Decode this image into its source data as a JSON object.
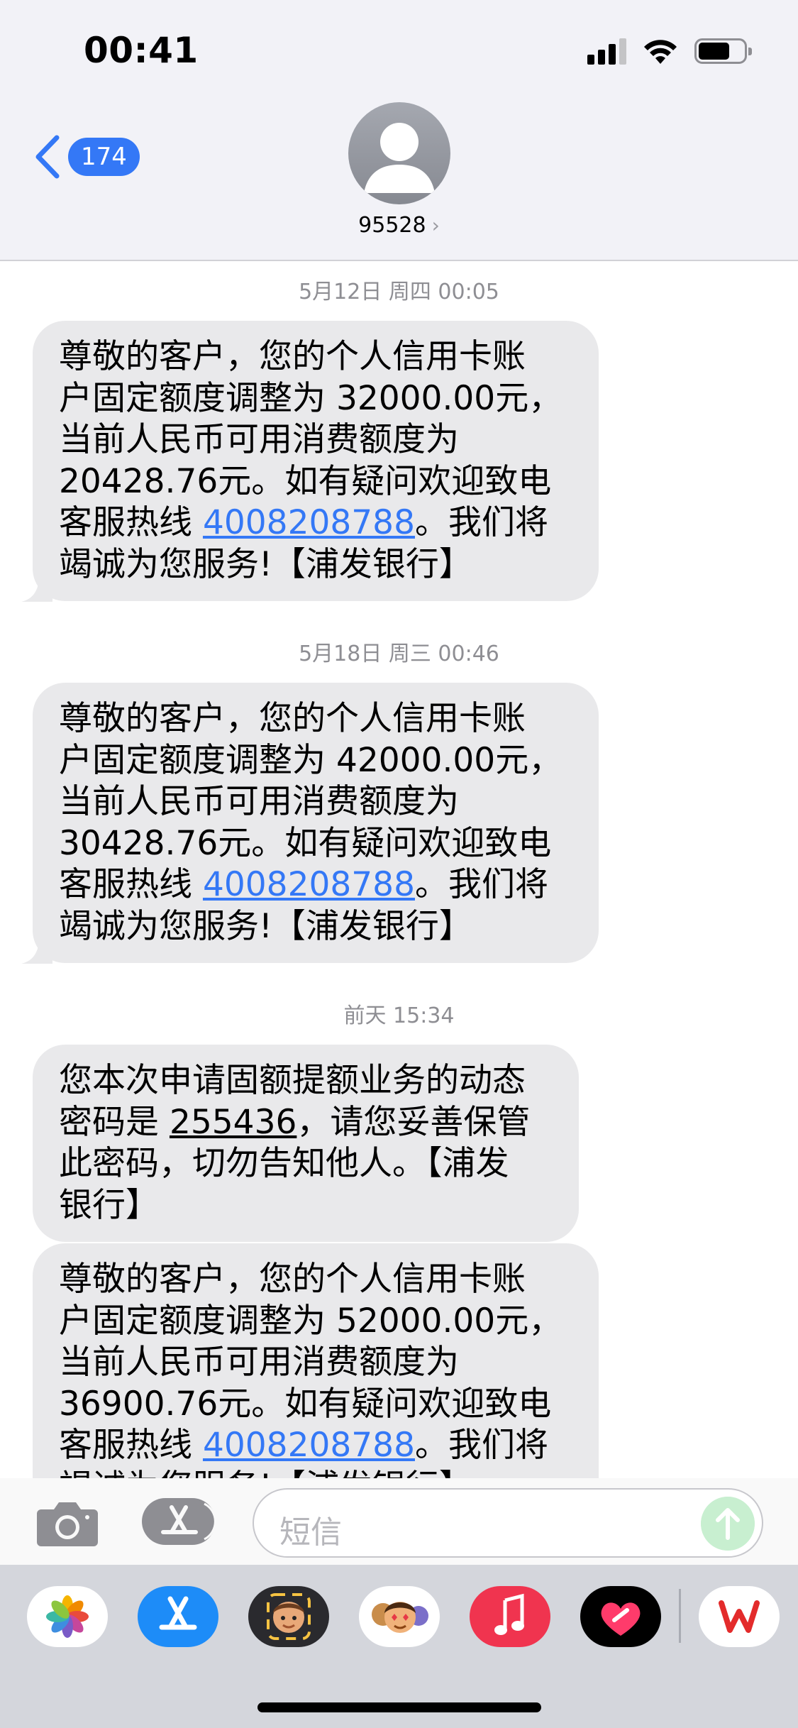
{
  "status_bar": {
    "time": "00:41"
  },
  "header": {
    "back_count": "174",
    "contact_name": "95528",
    "contact_chevron": "›"
  },
  "messages": [
    {
      "timestamp": "5月12日 周四 00:05",
      "before_link": "尊敬的客户，您的个人信用卡账\n户固定额度调整为 32000.00元，\n当前人民币可用消费额度为\n20428.76元。如有疑问欢迎致电\n客服热线 ",
      "link": "4008208788",
      "after_link": "。我们将\n竭诚为您服务!【浦发银行】"
    },
    {
      "timestamp": "5月18日 周三 00:46",
      "before_link": "尊敬的客户，您的个人信用卡账\n户固定额度调整为 42000.00元，\n当前人民币可用消费额度为\n30428.76元。如有疑问欢迎致电\n客服热线 ",
      "link": "4008208788",
      "after_link": "。我们将\n竭诚为您服务!【浦发银行】"
    },
    {
      "timestamp": "前天 15:34",
      "before_code": "您本次申请固额提额业务的动态\n密码是 ",
      "code": "255436",
      "after_code": "，请您妥善保管\n此密码，切勿告知他人。【浦发\n银行】"
    },
    {
      "before_link": "尊敬的客户，您的个人信用卡账\n户固定额度调整为 52000.00元，\n当前人民币可用消费额度为\n36900.76元。如有疑问欢迎致电\n客服热线 ",
      "link": "4008208788",
      "after_link": "。我们将\n竭诚为您服务!【浦发银行】"
    }
  ],
  "input": {
    "placeholder": "短信"
  },
  "icons": {
    "status": [
      "signal-icon",
      "wifi-icon",
      "battery-icon"
    ],
    "toolbar": [
      "camera-icon",
      "app-store-icon",
      "send-arrow-icon"
    ],
    "drawer": [
      "photos-app-icon",
      "app-store-app-icon",
      "memoji-sticker-icon",
      "animoji-icon",
      "music-app-icon",
      "digital-touch-icon",
      "wps-office-icon"
    ]
  },
  "colors": {
    "accent": "#3478f6",
    "bubble_incoming": "#e9e9eb",
    "header_bg": "#f2f2f7",
    "timestamp": "#8e8e93",
    "send_button_disabled": "#c8efd0"
  }
}
